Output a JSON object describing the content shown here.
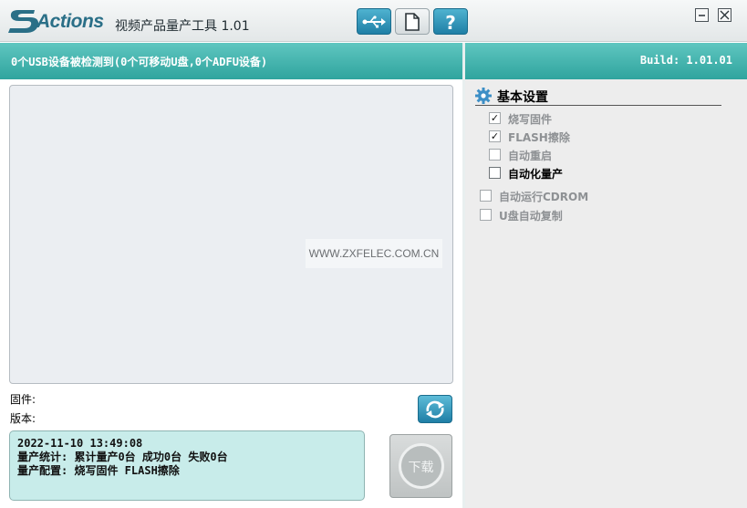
{
  "titlebar": {
    "brand": "Actions",
    "title": "视频产品量产工具 1.01",
    "buttons": {
      "usb_icon": "usb-icon",
      "doc_icon": "document-icon",
      "help_label": "?"
    },
    "window_controls": {
      "minimize_icon": "minimize-icon",
      "close_icon": "close-icon"
    }
  },
  "status": {
    "message": "0个USB设备被检测到(0个可移动U盘,0个ADFU设备)",
    "build": "Build: 1.01.01"
  },
  "left": {
    "watermark": "WWW.ZXFELEC.COM.CN",
    "firmware_label": "固件:",
    "version_label": "版本:",
    "refresh_icon": "refresh-icon",
    "log": [
      "2022-11-10 13:49:08",
      "量产统计: 累计量产0台 成功0台 失败0台",
      "量产配置: 烧写固件 FLASH擦除"
    ],
    "download_label": "下载"
  },
  "settings": {
    "title": "基本设置",
    "gear_icon": "gear-icon",
    "options": [
      {
        "label": "烧写固件",
        "checked": true,
        "enabled": false
      },
      {
        "label": "FLASH擦除",
        "checked": true,
        "enabled": false
      },
      {
        "label": "自动重启",
        "checked": false,
        "enabled": false
      },
      {
        "label": "自动化量产",
        "checked": false,
        "enabled": true
      }
    ],
    "extra_options": [
      {
        "label": "自动运行CDROM",
        "checked": false,
        "enabled": false
      },
      {
        "label": "U盘自动复制",
        "checked": false,
        "enabled": false
      }
    ]
  },
  "colors": {
    "accent": "#2fa49e",
    "brand": "#2a6f87",
    "log_bg": "#c8ecea"
  }
}
